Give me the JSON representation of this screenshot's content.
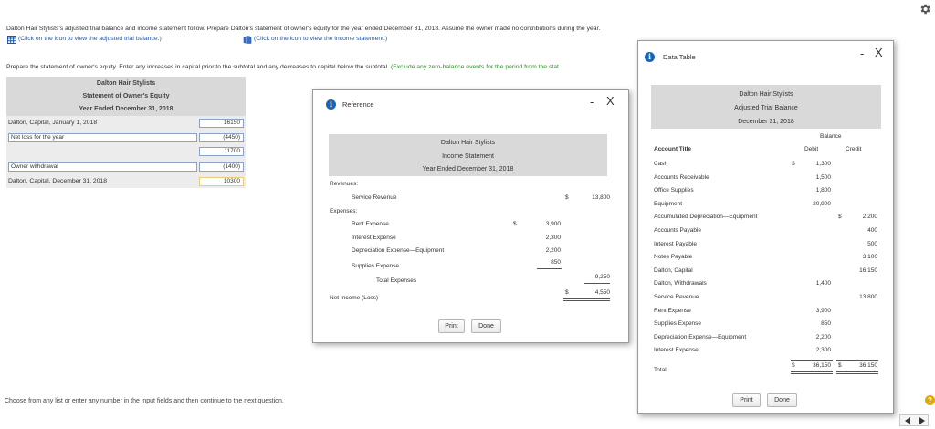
{
  "intro": {
    "line1": "Dalton Hair Stylists's adjusted trial balance and income statement follow. Prepare Dalton's statement of owner's equity for the year ended December 31, 2018. Assume the owner made no contributions during the year.",
    "link1": "(Click on the icon to view the adjusted trial balance.)",
    "link2": "(Click on the icon to view the income statement.)",
    "instruction": "Prepare the statement of owner's equity. Enter any increases in capital prior to the subtotal and any decreases to capital below the subtotal.",
    "instruction_green": "(Exclude any zero-balance events for the period from the stat"
  },
  "equity": {
    "company": "Dalton Hair Stylists",
    "title": "Statement of Owner's Equity",
    "period": "Year Ended December 31, 2018",
    "row1_label": "Dalton, Capital, January 1, 2018",
    "row1_value": "16150",
    "row2_label": "Net loss for the year",
    "row2_value": "(4450)",
    "subtotal": "11700",
    "row3_label": "Owner withdrawal",
    "row3_value": "(1400)",
    "row4_label": "Dalton, Capital, December 31, 2018",
    "row4_value": "10300"
  },
  "footer": {
    "hint": "Choose from any list or enter any number in the input fields and then continue to the next question."
  },
  "reference": {
    "title": "Reference",
    "minimize": "-",
    "close": "X",
    "company": "Dalton Hair Stylists",
    "statement": "Income Statement",
    "period": "Year Ended December 31, 2018",
    "revenues_label": "Revenues:",
    "service_revenue": "Service Revenue",
    "service_revenue_dollar": "$",
    "service_revenue_amount": "13,800",
    "expenses_label": "Expenses:",
    "rent_expense": "Rent Expense",
    "rent_dollar": "$",
    "rent_amount": "3,900",
    "interest_expense": "Interest Expense",
    "interest_amount": "2,300",
    "depreciation_expense": "Depreciation Expense—Equipment",
    "depreciation_amount": "2,200",
    "supplies_expense": "Supplies Expense",
    "supplies_amount": "850",
    "total_expenses": "Total Expenses",
    "total_expenses_amount": "9,250",
    "net_income": "Net Income (Loss)",
    "net_income_dollar": "$",
    "net_income_amount": "4,550",
    "print": "Print",
    "done": "Done"
  },
  "data_table": {
    "title": "Data Table",
    "minimize": "-",
    "close": "X",
    "company": "Dalton Hair Stylists",
    "statement": "Adjusted Trial Balance",
    "date": "December 31, 2018",
    "balance_header": "Balance",
    "col_account": "Account Title",
    "col_debit": "Debit",
    "col_credit": "Credit",
    "rows": [
      {
        "account": "Cash",
        "debit_sign": "$",
        "debit": "1,300",
        "credit_sign": "",
        "credit": ""
      },
      {
        "account": "Accounts Receivable",
        "debit_sign": "",
        "debit": "1,500",
        "credit_sign": "",
        "credit": ""
      },
      {
        "account": "Office Supplies",
        "debit_sign": "",
        "debit": "1,800",
        "credit_sign": "",
        "credit": ""
      },
      {
        "account": "Equipment",
        "debit_sign": "",
        "debit": "20,900",
        "credit_sign": "",
        "credit": ""
      },
      {
        "account": "Accumulated Depreciation—Equipment",
        "debit_sign": "",
        "debit": "",
        "credit_sign": "$",
        "credit": "2,200"
      },
      {
        "account": "Accounts Payable",
        "debit_sign": "",
        "debit": "",
        "credit_sign": "",
        "credit": "400"
      },
      {
        "account": "Interest Payable",
        "debit_sign": "",
        "debit": "",
        "credit_sign": "",
        "credit": "500"
      },
      {
        "account": "Notes Payable",
        "debit_sign": "",
        "debit": "",
        "credit_sign": "",
        "credit": "3,100"
      },
      {
        "account": "Dalton, Capital",
        "debit_sign": "",
        "debit": "",
        "credit_sign": "",
        "credit": "16,150"
      },
      {
        "account": "Dalton, Withdrawals",
        "debit_sign": "",
        "debit": "1,400",
        "credit_sign": "",
        "credit": ""
      },
      {
        "account": "Service Revenue",
        "debit_sign": "",
        "debit": "",
        "credit_sign": "",
        "credit": "13,800"
      },
      {
        "account": "Rent Expense",
        "debit_sign": "",
        "debit": "3,900",
        "credit_sign": "",
        "credit": ""
      },
      {
        "account": "Supplies Expense",
        "debit_sign": "",
        "debit": "850",
        "credit_sign": "",
        "credit": ""
      },
      {
        "account": "Depreciation Expense—Equipment",
        "debit_sign": "",
        "debit": "2,200",
        "credit_sign": "",
        "credit": ""
      },
      {
        "account": "Interest Expense",
        "debit_sign": "",
        "debit": "2,300",
        "credit_sign": "",
        "credit": ""
      }
    ],
    "total_label": "Total",
    "total_debit_sign": "$",
    "total_debit": "36,150",
    "total_credit_sign": "$",
    "total_credit": "36,150",
    "print": "Print",
    "done": "Done"
  },
  "icons": {
    "settings": "gear-icon",
    "help": "help-icon",
    "prev": "arrow-left-icon",
    "next": "arrow-right-icon",
    "table": "table-icon",
    "statement": "book-icon",
    "info": "info-icon"
  },
  "colors": {
    "link": "#1a58b8",
    "note_green": "#2c8b2c",
    "info_blue": "#1665b8",
    "header_grey": "#d9d9d9",
    "help_yellow": "#e0a800"
  }
}
